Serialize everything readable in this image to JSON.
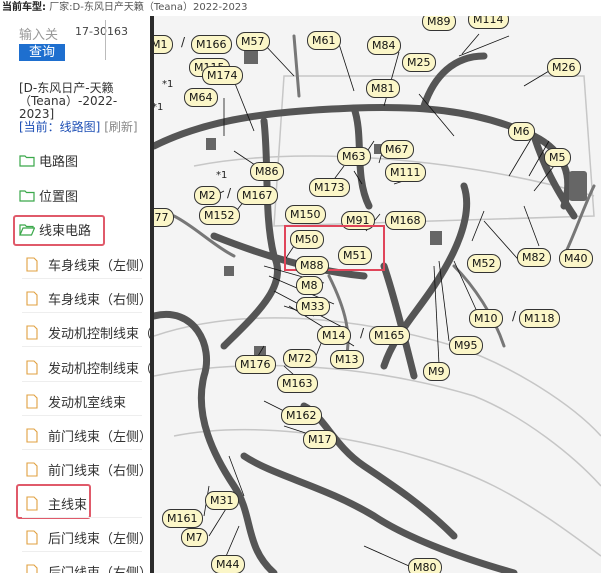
{
  "topbar": {
    "label": "当前车型:",
    "value": "厂家:D-东风日产天籁（Teana）2022-2023"
  },
  "search": {
    "label": "输入关",
    "value": "17-30163",
    "button": "查询"
  },
  "vehicle": "[D-东风日产-天籁（Teana）-2022-2023]",
  "current": {
    "label": "[当前：线路图]",
    "refresh": "[刷新]"
  },
  "tree": {
    "folders": [
      "电路图",
      "位置图",
      "线束电路"
    ],
    "files": [
      "车身线束（左侧）",
      "车身线束（右侧）",
      "发动机控制线束（",
      "发动机控制线束（",
      "发动机室线束",
      "前门线束（左侧）",
      "前门线束（右侧）",
      "主线束",
      "后门线束（左侧）",
      "后门线束（右侧）"
    ]
  },
  "diagram": {
    "tags": [
      "M89",
      "M114",
      "M1",
      "M166",
      "M57",
      "M61",
      "M84",
      "M25",
      "M26",
      "M115",
      "M174",
      "M64",
      "M81",
      "M6",
      "M5",
      "M63",
      "M67",
      "M111",
      "M86",
      "M2",
      "M167",
      "M173",
      "M152",
      "M91",
      "M168",
      "M150",
      "M77",
      "M50",
      "M51",
      "M88",
      "M82",
      "M40",
      "M8",
      "M52",
      "M33",
      "M10",
      "M118",
      "M14",
      "M165",
      "M95",
      "M13",
      "M72",
      "M176",
      "M9",
      "M163",
      "M162",
      "M17",
      "M31",
      "M161",
      "M7",
      "M44",
      "M80"
    ],
    "stars": [
      "*1",
      "*1",
      "*1"
    ]
  },
  "colors": {
    "accent": "#1e6fcf",
    "highlight": "#e05a6a",
    "tag_fill": "#fbf6c8"
  }
}
